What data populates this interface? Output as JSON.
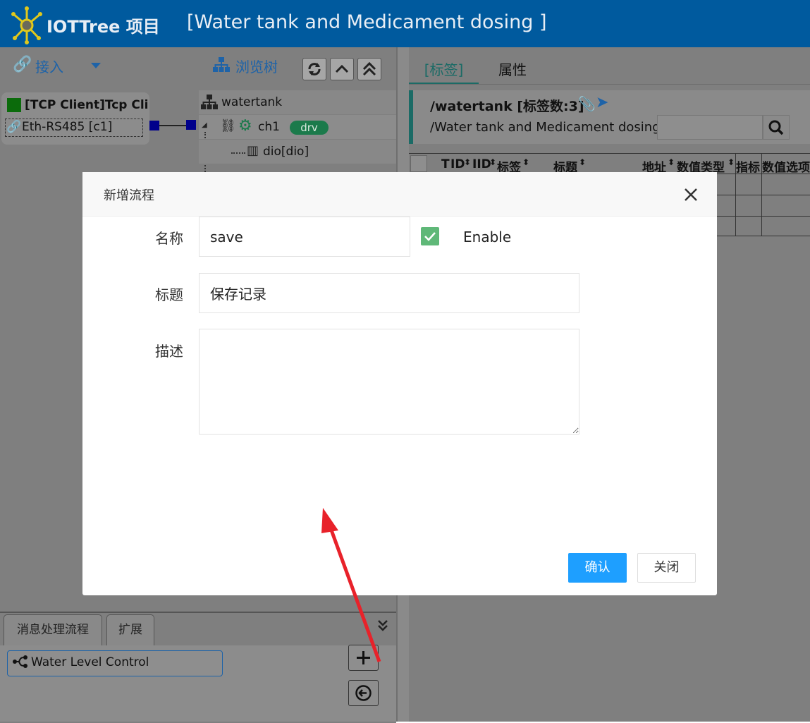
{
  "header": {
    "brand": "IOTTree 项目",
    "project_title": "[Water tank and Medicament dosing ]"
  },
  "left_toolbar": {
    "connect_label": "接入",
    "browse_tree_label": "浏览树"
  },
  "connections": {
    "client_label": "[TCP Client]Tcp Clier",
    "channel_label": "Eth-RS485 [c1]"
  },
  "tree": {
    "root_label": "watertank",
    "channel_label": "ch1",
    "channel_badge": "drv",
    "device_label": "dio[dio]"
  },
  "right_panel": {
    "tabs": [
      {
        "label": "[标签]"
      },
      {
        "label": "属性"
      }
    ],
    "path_title": "/watertank [标签数:3]",
    "path_desc": "/Water tank and Medicament dosing",
    "search_value": "",
    "table_headers": [
      "T",
      "ID",
      "IID",
      "标签",
      "标题",
      "地址",
      "数值类型",
      "指标",
      "数值选项"
    ]
  },
  "bottom_left": {
    "tabs": [
      {
        "label": "消息处理流程"
      },
      {
        "label": "扩展"
      }
    ],
    "flows": [
      {
        "label": "Water Level Control"
      }
    ]
  },
  "dialog": {
    "title": "新增流程",
    "name_label": "名称",
    "name_value": "save",
    "enable_label": "Enable",
    "enabled": true,
    "title_label": "标题",
    "title_value": "保存记录",
    "desc_label": "描述",
    "desc_value": "",
    "confirm_label": "确认",
    "close_label": "关闭"
  },
  "colors": {
    "header_bg": "#005a9e",
    "primary_button": "#1e9fff",
    "checkbox": "#5fb878",
    "arrow": "#e8222a"
  }
}
